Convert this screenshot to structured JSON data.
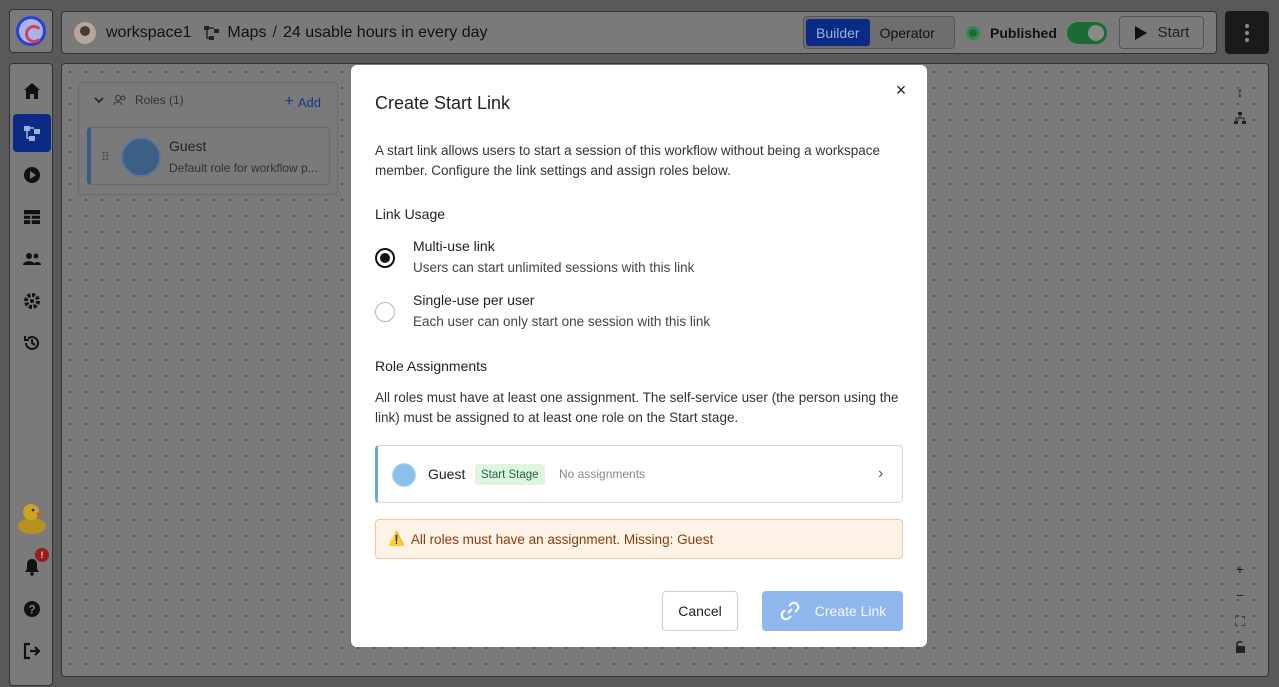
{
  "topbar": {
    "workspace": "workspace1",
    "breadcrumb_section": "Maps",
    "breadcrumb_separator": "/",
    "breadcrumb_page": "24 usable hours in every day",
    "mode_builder": "Builder",
    "mode_operator": "Operator",
    "published_label": "Published",
    "start_label": "Start"
  },
  "sidebar": {
    "notification_count": "!"
  },
  "roles_panel": {
    "header": "Roles (1)",
    "add_label": "Add",
    "role_name": "Guest",
    "role_desc": "Default role for workflow p..."
  },
  "modal": {
    "title": "Create Start Link",
    "close_glyph": "×",
    "description": "A start link allows users to start a session of this workflow without being a workspace member. Configure the link settings and assign roles below.",
    "link_usage_heading": "Link Usage",
    "options": [
      {
        "title": "Multi-use link",
        "subtitle": "Users can start unlimited sessions with this link",
        "selected": true
      },
      {
        "title": "Single-use per user",
        "subtitle": "Each user can only start one session with this link",
        "selected": false
      }
    ],
    "role_assignments_heading": "Role Assignments",
    "role_assignments_desc": "All roles must have at least one assignment. The self-service user (the person using the link) must be assigned to at least one role on the Start stage.",
    "assignment": {
      "role": "Guest",
      "stage_badge": "Start Stage",
      "status": "No assignments"
    },
    "warning_icon": "⚠️",
    "warning": "All roles must have an assignment. Missing: Guest",
    "cancel_label": "Cancel",
    "create_label": "Create Link"
  },
  "colors": {
    "primary": "#0b2a86",
    "published_green": "#1b6b35",
    "create_button": "#8fb7ee",
    "warning_bg": "#fdf2e6",
    "warning_text": "#8a3c0e",
    "stage_badge_bg": "#dff5e4"
  }
}
